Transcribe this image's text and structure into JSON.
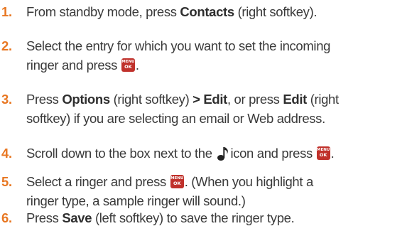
{
  "steps": [
    {
      "number": "1.",
      "line1": {
        "text_a": "From standby mode, press ",
        "bold_a": "Contacts",
        "text_b": " (right softkey)."
      }
    },
    {
      "number": "2.",
      "line1": {
        "text_a": "Select the entry for which you want to set the incoming"
      },
      "line2": {
        "text_a": "ringer and press ",
        "icon": "menu-ok-key-icon",
        "text_b": "."
      }
    },
    {
      "number": "3.",
      "line1": {
        "text_a": "Press ",
        "bold_a": "Options",
        "text_b": " (right softkey) ",
        "bold_b": "> Edit",
        "text_c": ", or press ",
        "bold_c": "Edit",
        "text_d": " (right"
      },
      "line2": {
        "text_a": "softkey) if you are selecting an email or Web address."
      }
    },
    {
      "number": "4.",
      "line1": {
        "text_a": "Scroll down to the box next to the ",
        "icon1": "music-note-icon",
        "text_b": "icon and press ",
        "icon2": "menu-ok-key-icon",
        "text_c": "."
      }
    },
    {
      "number": "5.",
      "line1": {
        "text_a": "Select a ringer and press ",
        "icon": "menu-ok-key-icon",
        "text_b": ". (When you highlight a"
      },
      "line2": {
        "text_a": "ringer type, a sample ringer will sound.)"
      }
    },
    {
      "number": "6.",
      "line1": {
        "text_a": "Press ",
        "bold_a": "Save",
        "text_b": " (left softkey) to save the ringer type."
      }
    }
  ],
  "key_icon": {
    "top": "MENU",
    "bottom": "OK",
    "color": "#c0312b"
  },
  "colors": {
    "step_number": "#e87722",
    "text": "#3a3a3a"
  }
}
